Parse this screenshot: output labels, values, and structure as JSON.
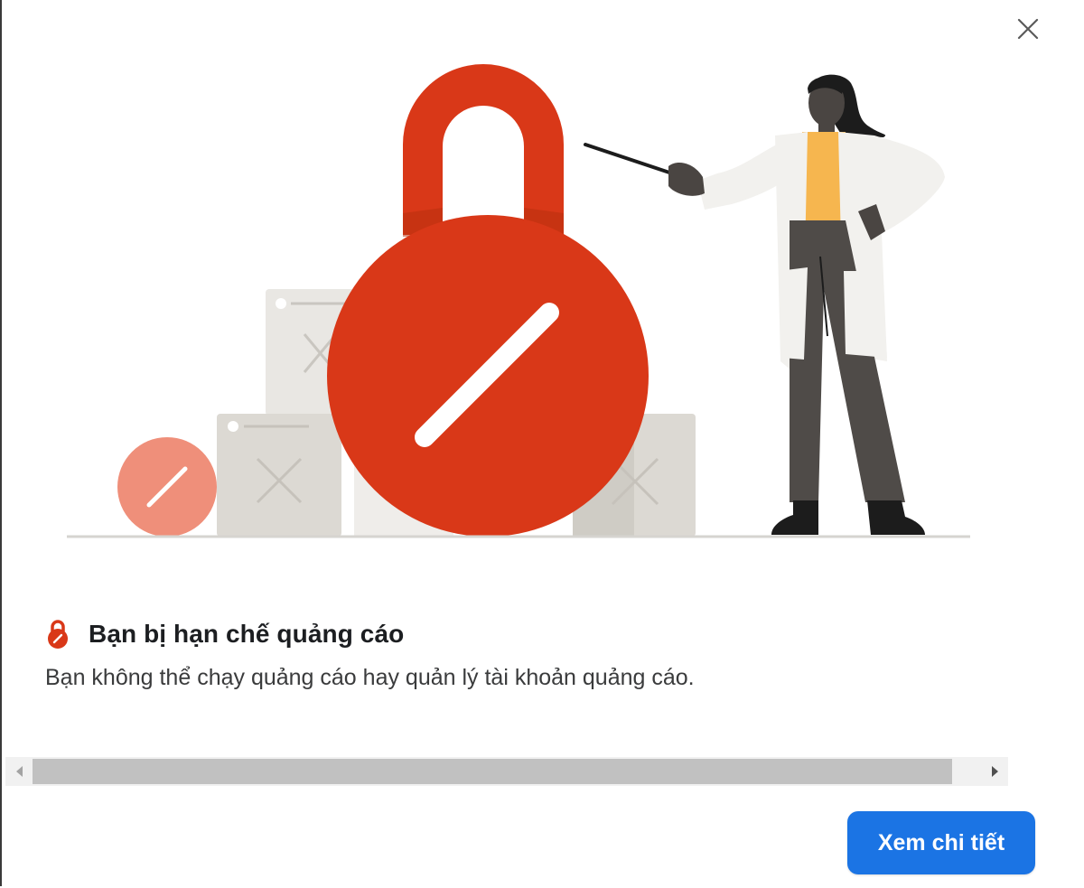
{
  "dialog": {
    "close_icon": "close-icon",
    "title": "Bạn bị hạn chế quảng cáo",
    "title_icon": "padlock-restricted-icon",
    "description": "Bạn không thể chạy quảng cáo hay quản lý tài khoản quảng cáo.",
    "primary_button_label": "Xem chi tiết"
  },
  "colors": {
    "accent": "#1b74e4",
    "lock_red": "#d93818",
    "badge_salmon": "#ef8f7a"
  }
}
